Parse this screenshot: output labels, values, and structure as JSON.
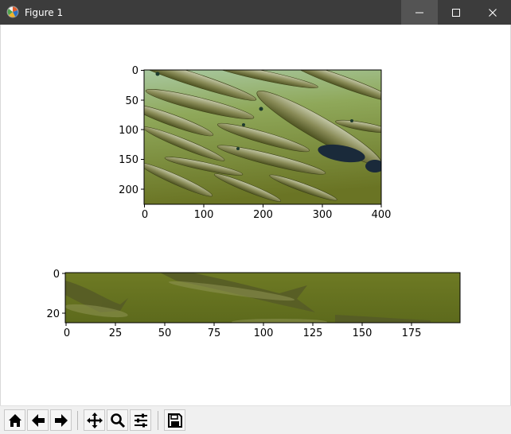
{
  "window": {
    "title": "Figure 1"
  },
  "icons": {
    "app": "matplotlib-figure-icon",
    "minimize": "minimize-icon",
    "maximize": "maximize-icon",
    "close": "close-icon"
  },
  "figure": {
    "subplots": [
      {
        "kind": "image",
        "content": "school of barracuda fish underwater, olive-green water",
        "x_ticks": [
          "0",
          "100",
          "200",
          "300",
          "400"
        ],
        "y_ticks": [
          "0",
          "50",
          "100",
          "150",
          "200"
        ]
      },
      {
        "kind": "image",
        "content": "cropped strip of the same fish image",
        "x_ticks": [
          "0",
          "25",
          "50",
          "75",
          "100",
          "125",
          "150",
          "175"
        ],
        "y_ticks": [
          "0",
          "20"
        ]
      }
    ]
  },
  "toolbar": {
    "buttons": [
      {
        "name": "home",
        "icon": "home-icon"
      },
      {
        "name": "back",
        "icon": "back-arrow-icon"
      },
      {
        "name": "forward",
        "icon": "forward-arrow-icon"
      },
      {
        "name": "pan",
        "icon": "move-icon"
      },
      {
        "name": "zoom",
        "icon": "zoom-icon"
      },
      {
        "name": "configure-subplots",
        "icon": "sliders-icon"
      },
      {
        "name": "save",
        "icon": "save-icon"
      }
    ]
  },
  "colors": {
    "titlebar": "#3c3c3c",
    "water_light": "#9cc08c",
    "water_dark": "#66701c",
    "fish_body": "#8c8c5a",
    "toolbar_bg": "#f0f0f0"
  }
}
